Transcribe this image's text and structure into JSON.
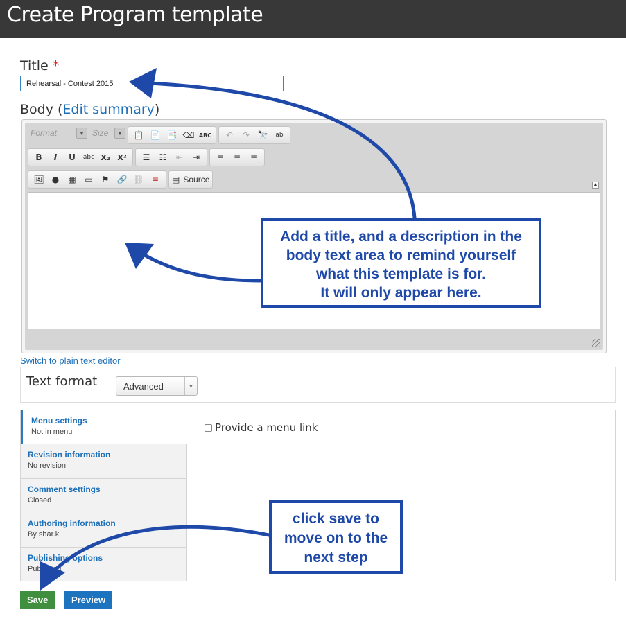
{
  "page": {
    "title": "Create Program template"
  },
  "title_field": {
    "label": "Title",
    "required_mark": "*",
    "value": "Rehearsal - Contest 2015"
  },
  "body_field": {
    "label": "Body (",
    "edit_summary_link": "Edit summary",
    "label_close": ")"
  },
  "toolbar": {
    "format_combo": "Format",
    "size_combo": "Size",
    "source_label": "Source",
    "bold": "B",
    "italic": "I",
    "underline": "U",
    "strikethrough": "abc",
    "subscript": "X₂",
    "superscript": "X²"
  },
  "switch_editor_link": "Switch to plain text editor",
  "text_format": {
    "label": "Text format",
    "selected": "Advanced"
  },
  "vertical_tabs": [
    {
      "title": "Menu settings",
      "summary": "Not in menu"
    },
    {
      "title": "Revision information",
      "summary": "No revision"
    },
    {
      "title": "Comment settings",
      "summary": "Closed"
    },
    {
      "title": "Authoring information",
      "summary": "By shar.k"
    },
    {
      "title": "Publishing options",
      "summary": "Published"
    }
  ],
  "menu_link_checkbox": {
    "label": "Provide a menu link",
    "checked": false
  },
  "actions": {
    "save": "Save",
    "preview": "Preview"
  },
  "annotations": {
    "body_callout": [
      "Add a title, and a description in the",
      "body text area to remind yourself",
      "what this template is for.",
      "It will only appear here."
    ],
    "save_callout": [
      "click save to",
      "move on to the",
      "next step"
    ]
  },
  "colors": {
    "topbar": "#383838",
    "link": "#1d6fb8",
    "save": "#3f8f3f",
    "preview": "#1e73be",
    "annotation": "#1e49a8"
  }
}
